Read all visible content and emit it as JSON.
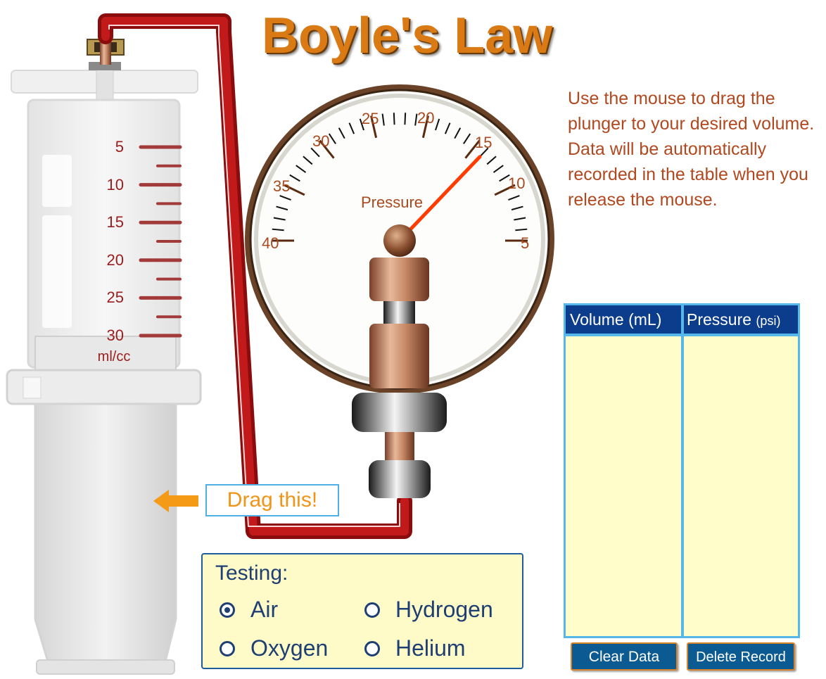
{
  "title": "Boyle's Law",
  "instructions": "Use the mouse to drag the plunger to your desired volume. Data will be automatically recorded in the table when you release the mouse.",
  "syringe": {
    "scale_labels": [
      "5",
      "10",
      "15",
      "20",
      "25",
      "30"
    ],
    "unit_label": "ml/cc"
  },
  "gauge": {
    "label": "Pressure",
    "scale_labels": [
      "40",
      "35",
      "30",
      "25",
      "20",
      "15",
      "10",
      "5"
    ],
    "needle_value": 14
  },
  "drag_hint": "Drag this!",
  "testing": {
    "label": "Testing:",
    "options": [
      "Air",
      "Hydrogen",
      "Oxygen",
      "Helium"
    ],
    "selected": "Air"
  },
  "table": {
    "col1_header": "Volume (mL)",
    "col2_header_main": "Pressure ",
    "col2_header_unit": "(psi)",
    "rows": []
  },
  "buttons": {
    "clear": "Clear Data",
    "delete": "Delete Record"
  },
  "colors": {
    "title": "#d97a14",
    "instructions": "#b2481f",
    "tube": "#9b0e0e",
    "needle": "#ff3b00",
    "table_header": "#0c3c8c",
    "table_border": "#56b7ea",
    "table_body": "#fffdc9"
  }
}
